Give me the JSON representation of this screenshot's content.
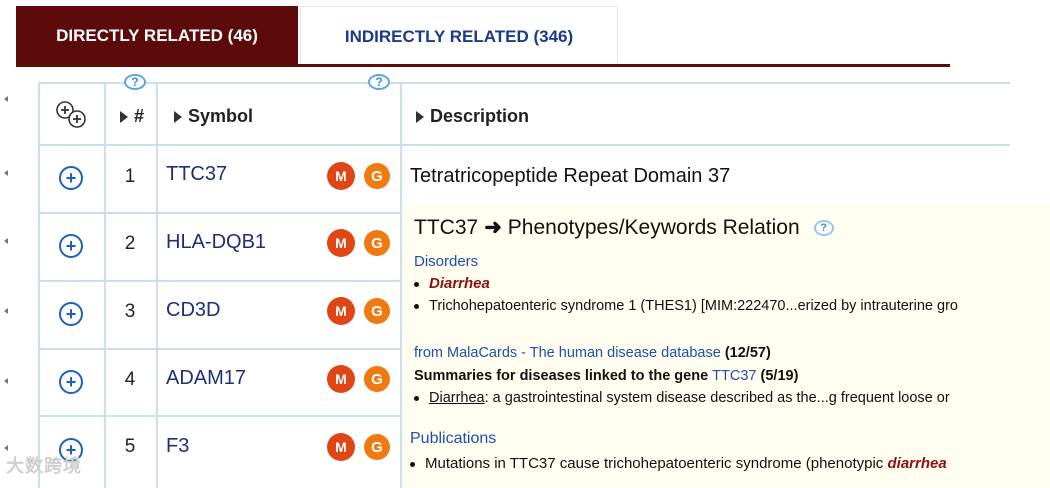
{
  "tabs": {
    "directly_related": "DIRECTLY RELATED (46)",
    "indirectly_related": "INDIRECTLY RELATED (346)"
  },
  "table": {
    "help_symbol": "?",
    "headers": {
      "number": "#",
      "symbol": "Symbol",
      "description": "Description"
    },
    "rows": [
      {
        "num": "1",
        "symbol": "TTC37"
      },
      {
        "num": "2",
        "symbol": "HLA-DQB1"
      },
      {
        "num": "3",
        "symbol": "CD3D"
      },
      {
        "num": "4",
        "symbol": "ADAM17"
      },
      {
        "num": "5",
        "symbol": "F3"
      }
    ],
    "row1_description": "Tetratricopeptide Repeat Domain 37"
  },
  "popup": {
    "gene": "TTC37",
    "title_rest": "Phenotypes/Keywords Relation",
    "help_symbol": "?",
    "disorders_heading": "Disorders",
    "disorder_1": "Diarrhea",
    "disorder_2": "Trichohepatoenteric syndrome 1 (THES1) [MIM:222470...erized by intrauterine gro",
    "malacards_link": "from MalaCards - The human disease database",
    "malacards_count": "(12/57)",
    "summaries_prefix": "Summaries for diseases linked to the gene",
    "summaries_gene": "TTC37",
    "summaries_count": "(5/19)",
    "summary_term": "Diarrhea",
    "summary_text": ": a gastrointestinal system disease described as the...g frequent loose or",
    "publications_heading": "Publications",
    "publication_text": "Mutations in TTC37 cause trichohepatoenteric syndrome (phenotypic",
    "publication_term": "diarrhea"
  },
  "watermark": "大数跨境",
  "colors": {
    "tab_active_bg": "#5c0a0a",
    "link_blue": "#1d2f7a",
    "grid_line": "#c9e1ef",
    "popup_bg": "#fffef0",
    "icon_red": "#e04516",
    "icon_orange": "#f07a10"
  },
  "icons": {
    "expand_all": "expand-all-icon",
    "row_expand": "plus-circle-icon",
    "sort": "triangle-right-icon",
    "malacards": "malacards-icon",
    "genecards": "genecards-icon",
    "arrow": "arrow-right-icon"
  }
}
